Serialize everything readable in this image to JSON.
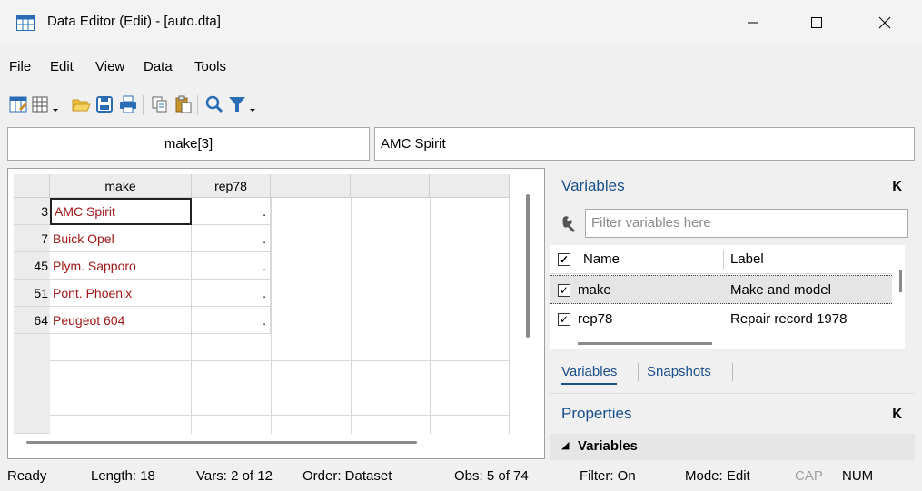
{
  "window": {
    "title": "Data Editor (Edit) - [auto.dta]"
  },
  "menu": [
    "File",
    "Edit",
    "View",
    "Data",
    "Tools"
  ],
  "toolbar_icons": [
    "data-editor-edit-icon",
    "data-editor-browse-icon",
    "open-icon",
    "save-icon",
    "print-icon",
    "copy-icon",
    "paste-icon",
    "find-icon",
    "filter-icon"
  ],
  "cell_name": "make[3]",
  "cell_value": "AMC Spirit",
  "grid": {
    "columns": [
      "make",
      "rep78"
    ],
    "rows": [
      {
        "num": "3",
        "make": "AMC Spirit",
        "rep78": "."
      },
      {
        "num": "7",
        "make": "Buick Opel",
        "rep78": "."
      },
      {
        "num": "45",
        "make": "Plym. Sapporo",
        "rep78": "."
      },
      {
        "num": "51",
        "make": "Pont. Phoenix",
        "rep78": "."
      },
      {
        "num": "64",
        "make": "Peugeot 604",
        "rep78": "."
      }
    ]
  },
  "variables_panel": {
    "title": "Variables",
    "filter_placeholder": "Filter variables here",
    "col_name": "Name",
    "col_label": "Label",
    "items": [
      {
        "name": "make",
        "label": "Make and model"
      },
      {
        "name": "rep78",
        "label": "Repair record 1978"
      }
    ],
    "tabs": [
      "Variables",
      "Snapshots"
    ]
  },
  "properties_panel": {
    "title": "Properties",
    "section": "Variables"
  },
  "status": {
    "ready": "Ready",
    "length": "Length: 18",
    "vars": "Vars: 2 of 12",
    "order": "Order: Dataset",
    "obs": "Obs: 5 of 74",
    "filter": "Filter: On",
    "mode": "Mode: Edit",
    "cap": "CAP",
    "num": "NUM"
  },
  "colors": {
    "accent": "#1a4f8c",
    "string_text": "#a01818"
  }
}
